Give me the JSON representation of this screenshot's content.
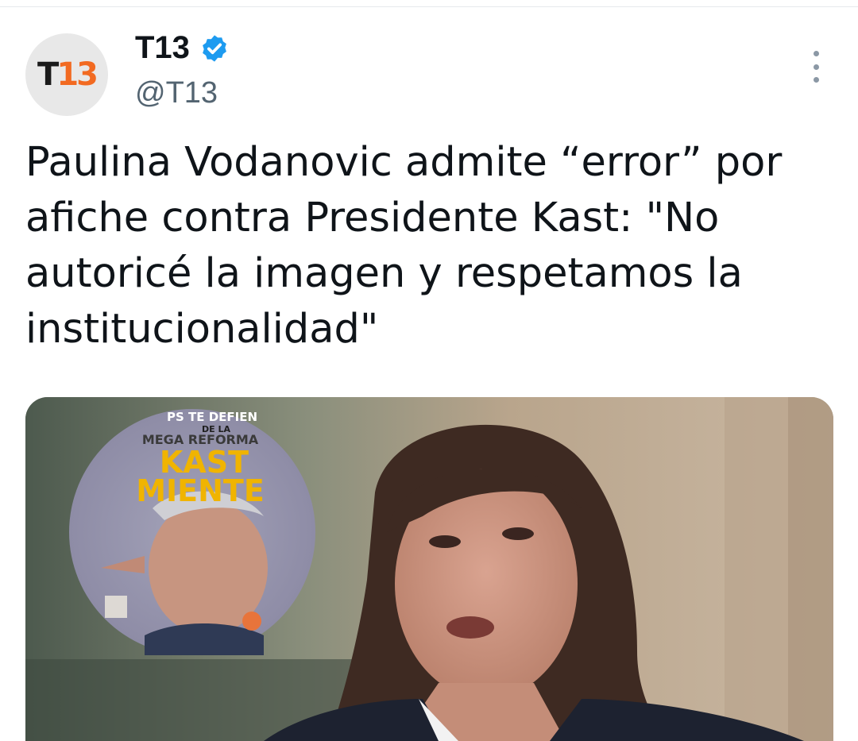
{
  "account": {
    "name": "T13",
    "handle": "@T13",
    "avatar_logo_t": "T",
    "avatar_logo_num": "13",
    "verified": true,
    "verified_icon": "verified-badge-icon",
    "more_icon": "more-vertical-icon"
  },
  "tweet": {
    "line1": "Paulina Vodanovic admite “error” por",
    "line2": "afiche contra Presidente Kast: \"No",
    "line3": "autoricé la imagen y respetamos la",
    "line4": "institucionalidad\""
  },
  "media": {
    "poster_line1": "PS TE DEFIEN",
    "poster_line2": "DE LA",
    "poster_line3": "MEGA REFORMA",
    "poster_line4": "KAST",
    "poster_line5": "MIENTE"
  },
  "colors": {
    "brand_orange": "#f26a21",
    "verified_blue": "#1d9bf0",
    "text_primary": "#0f1419",
    "text_secondary": "#536471"
  }
}
